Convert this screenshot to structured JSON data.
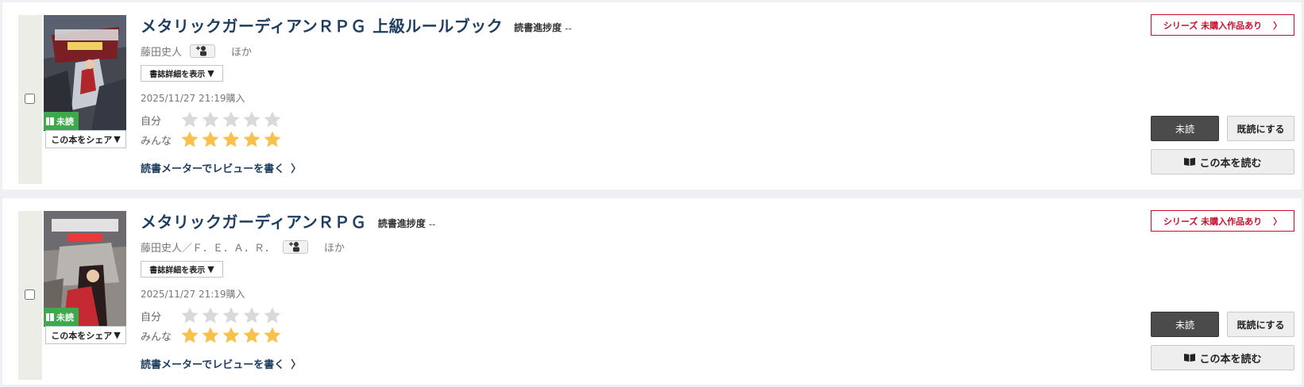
{
  "labels": {
    "progress_label": "読書進捗度",
    "progress_value": "--",
    "others": "ほか",
    "detail_button": "書誌詳細を表示",
    "detail_arrow": "▼",
    "share_button": "この本をシェア",
    "share_arrow": "▼",
    "unread_badge": "未読",
    "rating_self": "自分",
    "rating_all": "みんな",
    "review_link": "読書メーターでレビューを書く",
    "review_chevron": "〉",
    "series_button": "シリーズ 未購入作品あり",
    "series_chevron": "〉",
    "unread_button": "未読",
    "mark_read_button": "既読にする",
    "read_button": "この本を読む"
  },
  "colors": {
    "title": "#1e3e60",
    "unread_badge": "#3ea94a",
    "series_border": "#c8102e",
    "star_filled": "#f7c14b",
    "star_empty": "#d9d9d9"
  },
  "books": [
    {
      "title": "メタリックガーディアンＲＰＧ 上級ルールブック",
      "authors": "藤田史人",
      "purchase_date": "2025/11/27 21:19購入",
      "rating_self": 0,
      "rating_all": 5
    },
    {
      "title": "メタリックガーディアンＲＰＧ",
      "authors": "藤田史人／Ｆ．Ｅ．Ａ．Ｒ．",
      "purchase_date": "2025/11/27 21:19購入",
      "rating_self": 0,
      "rating_all": 5
    }
  ]
}
